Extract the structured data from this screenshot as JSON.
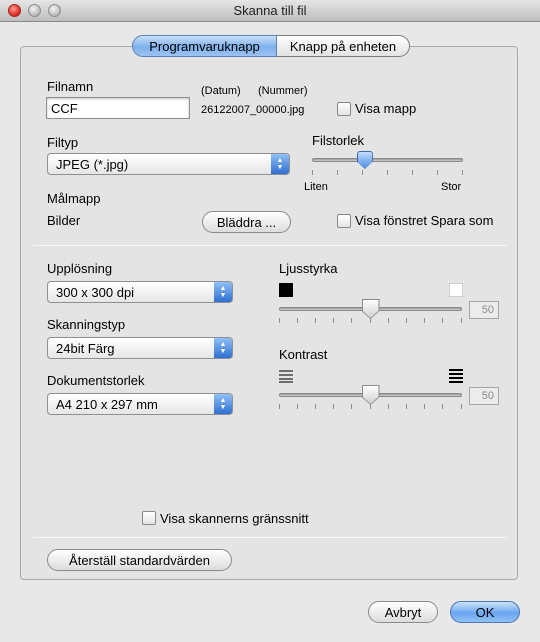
{
  "window": {
    "title": "Skanna till fil"
  },
  "tabs": [
    {
      "label": "Programvaruknapp",
      "selected": true
    },
    {
      "label": "Knapp på enheten",
      "selected": false
    }
  ],
  "file": {
    "name_label": "Filnamn",
    "name_value": "CCF",
    "date_label": "(Datum)",
    "number_label": "(Nummer)",
    "preview": "26122007_00000.jpg",
    "show_folder_label": "Visa mapp",
    "show_folder_checked": false
  },
  "filetype": {
    "label": "Filtyp",
    "value": "JPEG (*.jpg)"
  },
  "filesize": {
    "label": "Filstorlek",
    "min_label": "Liten",
    "max_label": "Stor",
    "level": 0.35
  },
  "destination": {
    "label": "Målmapp",
    "value": "Bilder",
    "browse_label": "Bläddra ...",
    "show_save_as_label": "Visa fönstret Spara som",
    "show_save_as_checked": false
  },
  "resolution": {
    "label": "Upplösning",
    "value": "300 x 300 dpi"
  },
  "scan_type": {
    "label": "Skanningstyp",
    "value": "24bit Färg"
  },
  "document_size": {
    "label": "Dokumentstorlek",
    "value": "A4  210 x 297 mm"
  },
  "brightness": {
    "label": "Ljusstyrka",
    "value": "50",
    "level": 0.5
  },
  "contrast": {
    "label": "Kontrast",
    "value": "50",
    "level": 0.5
  },
  "show_scanner_ui": {
    "label": "Visa skannerns gränssnitt",
    "checked": false
  },
  "buttons": {
    "restore": "Återställ standardvärden",
    "cancel": "Avbryt",
    "ok": "OK"
  }
}
